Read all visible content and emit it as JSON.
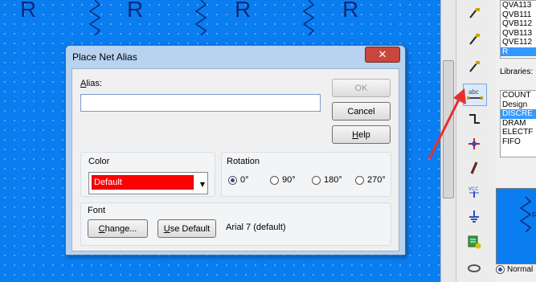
{
  "canvas": {
    "part_label": "R"
  },
  "dialog": {
    "title": "Place Net Alias",
    "close_glyph": "✕",
    "alias_label": "Alias:",
    "alias_value": "",
    "ok": "OK",
    "cancel": "Cancel",
    "help": "Help",
    "color_label": "Color",
    "color_value": "Default",
    "rotation_label": "Rotation",
    "rotations": [
      "0°",
      "90°",
      "180°",
      "270°"
    ],
    "rotation_selected": "0°",
    "font_label": "Font",
    "change": "Change...",
    "use_default": "Use Default",
    "font_value": "Arial 7 (default)"
  },
  "parts_list": [
    "QVA113",
    "QVB111",
    "QVB112",
    "QVB113",
    "QVE112",
    "R"
  ],
  "libraries_label": "Libraries:",
  "libraries_list": [
    "COUNT",
    "Design",
    "DISCRE",
    "DRAM",
    "ELECTF",
    "FIFO"
  ],
  "normal_label": "Normal",
  "colors": {
    "canvas": "#0a7df0",
    "arrow": "#e53030",
    "color_swatch": "#ff0000"
  }
}
